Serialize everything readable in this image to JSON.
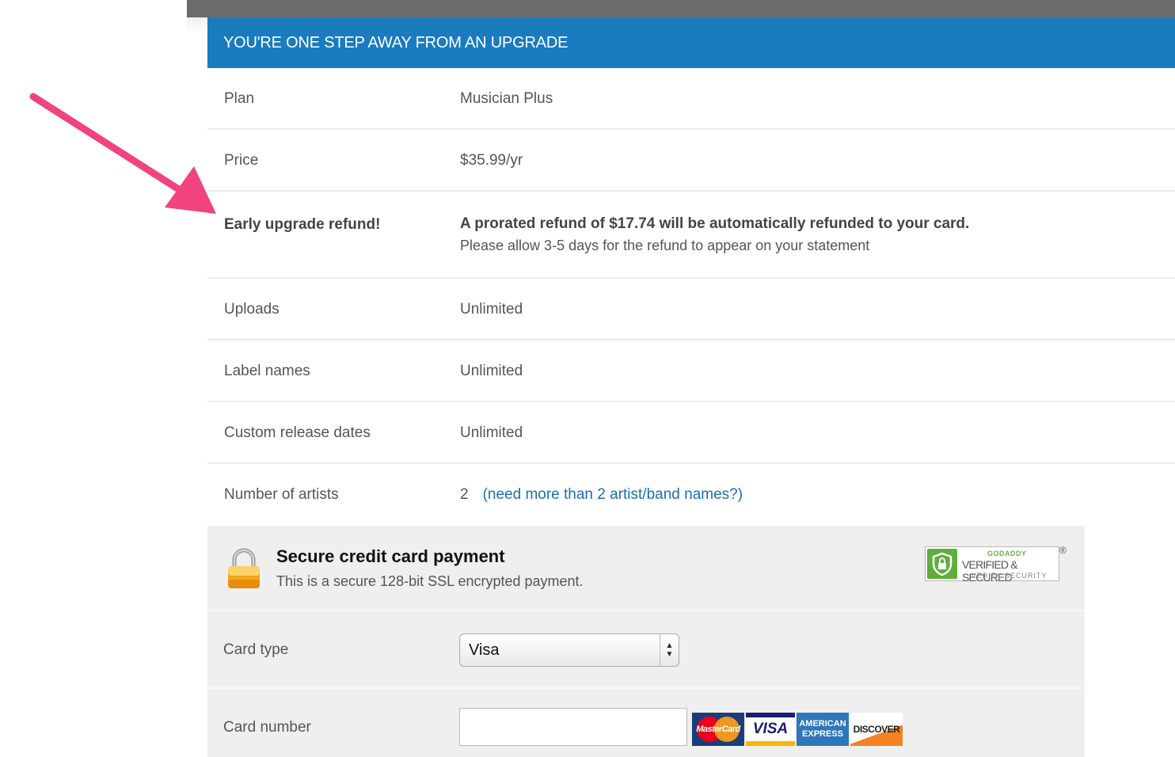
{
  "banner": {
    "title": "YOU'RE ONE STEP AWAY FROM AN UPGRADE"
  },
  "plan_rows": {
    "plan": {
      "label": "Plan",
      "value": "Musician Plus"
    },
    "price": {
      "label": "Price",
      "value": "$35.99/yr"
    },
    "refund": {
      "label": "Early upgrade refund!",
      "value": "A prorated refund of $17.74 will be automatically refunded to your card.",
      "note": "Please allow 3-5 days for the refund to appear on your statement"
    },
    "uploads": {
      "label": "Uploads",
      "value": "Unlimited"
    },
    "label_names": {
      "label": "Label names",
      "value": "Unlimited"
    },
    "release_dates": {
      "label": "Custom release dates",
      "value": "Unlimited"
    },
    "artists": {
      "label": "Number of artists",
      "value": "2",
      "link_open": "(",
      "link_text": "need more than 2 artist/band names?",
      "link_close": ")"
    }
  },
  "secure": {
    "title": "Secure credit card payment",
    "subtitle": "This is a secure 128-bit SSL encrypted payment.",
    "badge": {
      "top": "GODADDY",
      "middle": "VERIFIED & SECURED",
      "bottom": "VERIFY SECURITY",
      "reg": "®"
    }
  },
  "form": {
    "card_type": {
      "label": "Card type",
      "selected": "Visa"
    },
    "card_number": {
      "label": "Card number",
      "value": ""
    }
  },
  "card_logos": {
    "mastercard": "MasterCard",
    "visa": "VISA",
    "amex_1": "AMERICAN",
    "amex_2": "EXPRESS",
    "discover": "DISCOVER"
  },
  "colors": {
    "banner": "#1a7bbf",
    "arrow": "#f0437f",
    "link": "#1a6fb5"
  },
  "icons": [
    "lock-icon",
    "arrow-annotation",
    "select-arrows-icon",
    "shield-icon"
  ]
}
